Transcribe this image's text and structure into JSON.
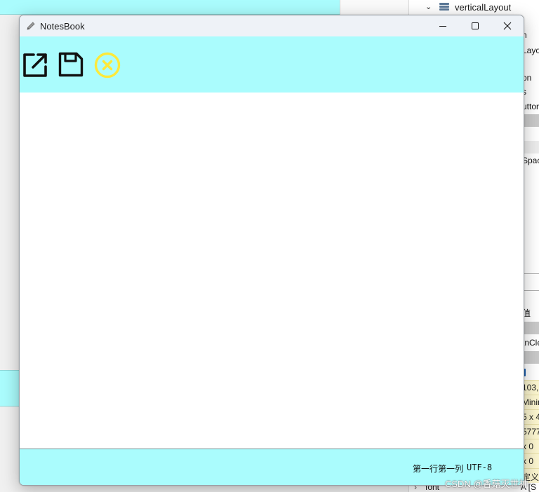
{
  "designer": {
    "tree_item": "verticalLayout",
    "right_panel_fragments": [
      "n",
      "Layo",
      "on",
      "s",
      "uttor",
      "Spac",
      "值",
      "tnCle",
      "103,",
      "Minin",
      "5 x 4",
      "5777",
      "x 0",
      "x 0",
      "定义"
    ],
    "font_row": {
      "name": "font",
      "value": "A [S"
    }
  },
  "window": {
    "title": "NotesBook",
    "icon": "pencil-icon",
    "controls": {
      "minimize": "minimize-icon",
      "maximize": "maximize-icon",
      "close": "close-icon"
    }
  },
  "toolbar": {
    "buttons": [
      {
        "id": "open",
        "icon": "open-external-icon",
        "color": "#111111"
      },
      {
        "id": "save",
        "icon": "save-floppy-icon",
        "color": "#111111"
      },
      {
        "id": "close",
        "icon": "circle-x-icon",
        "color": "#fde93a"
      }
    ],
    "background": "#aafcfd"
  },
  "editor": {
    "value": ""
  },
  "statusbar": {
    "position": "第一行第一列",
    "encoding": "UTF-8"
  },
  "watermark": "CSDN @香菇灭世神"
}
